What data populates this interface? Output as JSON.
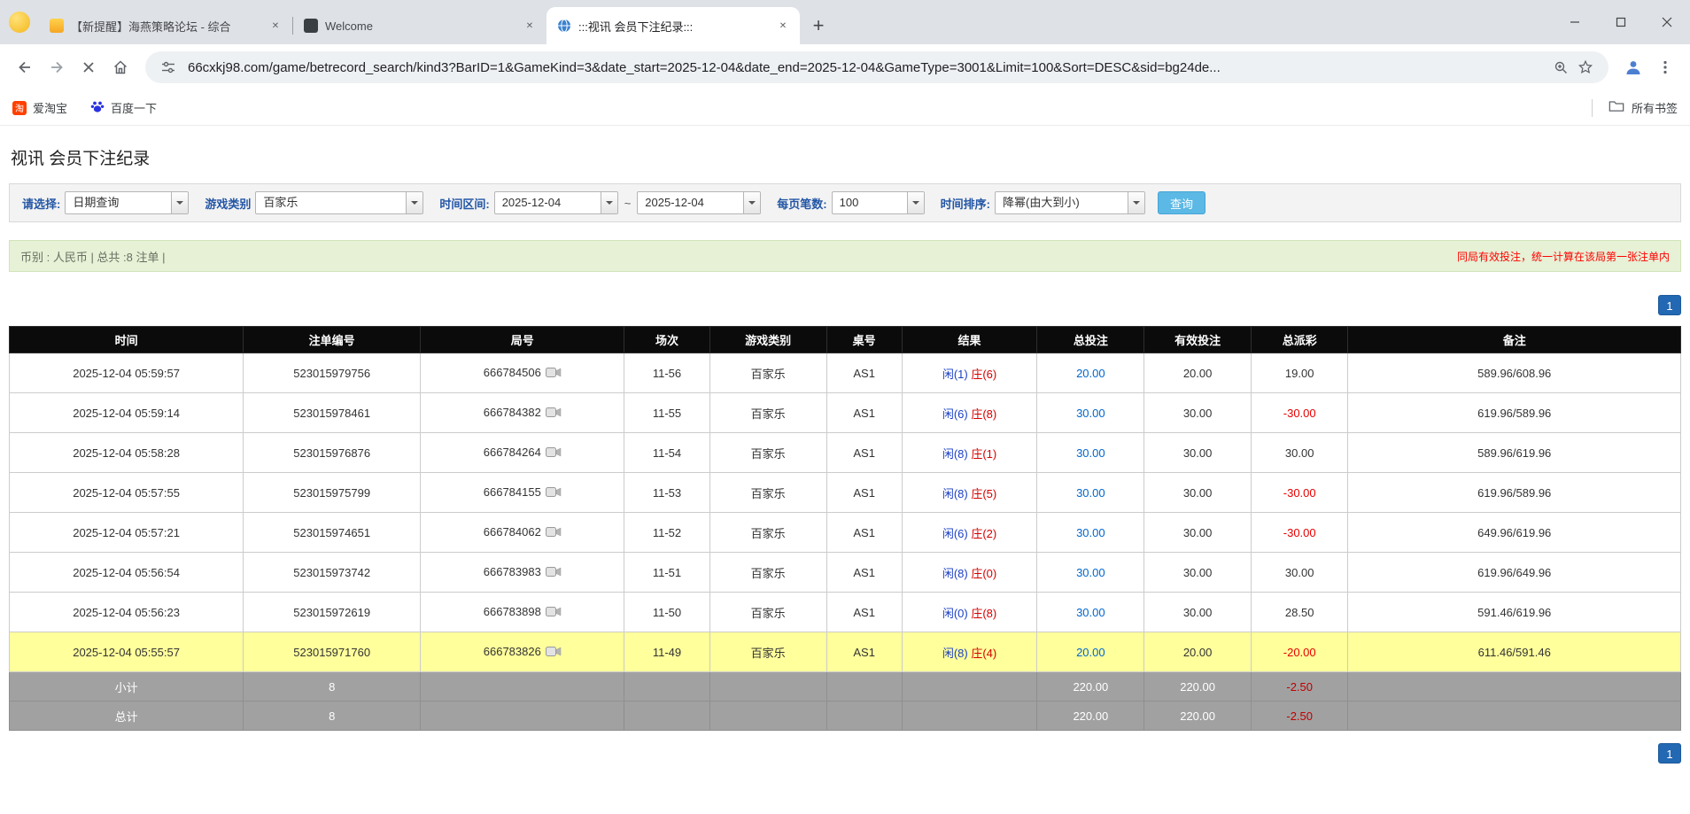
{
  "browser": {
    "tabs": [
      {
        "title": "【新提醒】海燕策略论坛 - 综合",
        "favicon": "forum-icon"
      },
      {
        "title": "Welcome",
        "favicon": "welcome-icon"
      },
      {
        "title": ":::视讯 会员下注纪录:::",
        "favicon": "globe-icon"
      }
    ],
    "url": "66cxkj98.com/game/betrecord_search/kind3?BarID=1&GameKind=3&date_start=2025-12-04&date_end=2025-12-04&GameType=3001&Limit=100&Sort=DESC&sid=bg24de...",
    "toolbar_icons": [
      "back-icon",
      "forward-icon",
      "stop-icon",
      "home-icon",
      "site-info-icon",
      "zoom-icon",
      "bookmark-star-icon",
      "profile-icon",
      "menu-icon"
    ],
    "bookmarks": {
      "items": [
        {
          "label": "爱淘宝",
          "icon": "taobao-icon"
        },
        {
          "label": "百度一下",
          "icon": "baidu-paw-icon"
        }
      ],
      "all_bookmarks_label": "所有书签"
    }
  },
  "page": {
    "title": "视讯 会员下注纪录",
    "filters": {
      "query_type": {
        "label": "请选择:",
        "value": "日期查询"
      },
      "game_category": {
        "label": "游戏类别",
        "value": "百家乐"
      },
      "date_range": {
        "label": "时间区间:",
        "start": "2025-12-04",
        "separator": "~",
        "end": "2025-12-04"
      },
      "page_size": {
        "label": "每页笔数:",
        "value": "100"
      },
      "sort": {
        "label": "时间排序:",
        "value": "降幂(由大到小)"
      },
      "search_button_label": "查询"
    },
    "summary": {
      "left": "币别 : 人民币 | 总共 :8 注单 |",
      "right": "同局有效投注，统一计算在该局第一张注单内"
    },
    "pagination": {
      "current": "1"
    },
    "table": {
      "headers": [
        "时间",
        "注单编号",
        "局号",
        "场次",
        "游戏类别",
        "桌号",
        "结果",
        "总投注",
        "有效投注",
        "总派彩",
        "备注"
      ],
      "rows": [
        {
          "time": "2025-12-04 05:59:57",
          "bet_id": "523015979756",
          "round": "666784506",
          "session": "11-56",
          "game_type": "百家乐",
          "table_no": "AS1",
          "result_player": "闲(1)",
          "result_banker": "庄(6)",
          "total_bet": "20.00",
          "valid_bet": "20.00",
          "payout": "19.00",
          "note": "589.96/608.96",
          "highlight": false
        },
        {
          "time": "2025-12-04 05:59:14",
          "bet_id": "523015978461",
          "round": "666784382",
          "session": "11-55",
          "game_type": "百家乐",
          "table_no": "AS1",
          "result_player": "闲(6)",
          "result_banker": "庄(8)",
          "total_bet": "30.00",
          "valid_bet": "30.00",
          "payout": "-30.00",
          "note": "619.96/589.96",
          "highlight": false
        },
        {
          "time": "2025-12-04 05:58:28",
          "bet_id": "523015976876",
          "round": "666784264",
          "session": "11-54",
          "game_type": "百家乐",
          "table_no": "AS1",
          "result_player": "闲(8)",
          "result_banker": "庄(1)",
          "total_bet": "30.00",
          "valid_bet": "30.00",
          "payout": "30.00",
          "note": "589.96/619.96",
          "highlight": false
        },
        {
          "time": "2025-12-04 05:57:55",
          "bet_id": "523015975799",
          "round": "666784155",
          "session": "11-53",
          "game_type": "百家乐",
          "table_no": "AS1",
          "result_player": "闲(8)",
          "result_banker": "庄(5)",
          "total_bet": "30.00",
          "valid_bet": "30.00",
          "payout": "-30.00",
          "note": "619.96/589.96",
          "highlight": false
        },
        {
          "time": "2025-12-04 05:57:21",
          "bet_id": "523015974651",
          "round": "666784062",
          "session": "11-52",
          "game_type": "百家乐",
          "table_no": "AS1",
          "result_player": "闲(6)",
          "result_banker": "庄(2)",
          "total_bet": "30.00",
          "valid_bet": "30.00",
          "payout": "-30.00",
          "note": "649.96/619.96",
          "highlight": false
        },
        {
          "time": "2025-12-04 05:56:54",
          "bet_id": "523015973742",
          "round": "666783983",
          "session": "11-51",
          "game_type": "百家乐",
          "table_no": "AS1",
          "result_player": "闲(8)",
          "result_banker": "庄(0)",
          "total_bet": "30.00",
          "valid_bet": "30.00",
          "payout": "30.00",
          "note": "619.96/649.96",
          "highlight": false
        },
        {
          "time": "2025-12-04 05:56:23",
          "bet_id": "523015972619",
          "round": "666783898",
          "session": "11-50",
          "game_type": "百家乐",
          "table_no": "AS1",
          "result_player": "闲(0)",
          "result_banker": "庄(8)",
          "total_bet": "30.00",
          "valid_bet": "30.00",
          "payout": "28.50",
          "note": "591.46/619.96",
          "highlight": false
        },
        {
          "time": "2025-12-04 05:55:57",
          "bet_id": "523015971760",
          "round": "666783826",
          "session": "11-49",
          "game_type": "百家乐",
          "table_no": "AS1",
          "result_player": "闲(8)",
          "result_banker": "庄(4)",
          "total_bet": "20.00",
          "valid_bet": "20.00",
          "payout": "-20.00",
          "note": "611.46/591.46",
          "highlight": true
        }
      ],
      "subtotal": {
        "label": "小计",
        "count": "8",
        "total_bet": "220.00",
        "valid_bet": "220.00",
        "payout": "-2.50"
      },
      "grand_total": {
        "label": "总计",
        "count": "8",
        "total_bet": "220.00",
        "valid_bet": "220.00",
        "payout": "-2.50"
      }
    }
  }
}
